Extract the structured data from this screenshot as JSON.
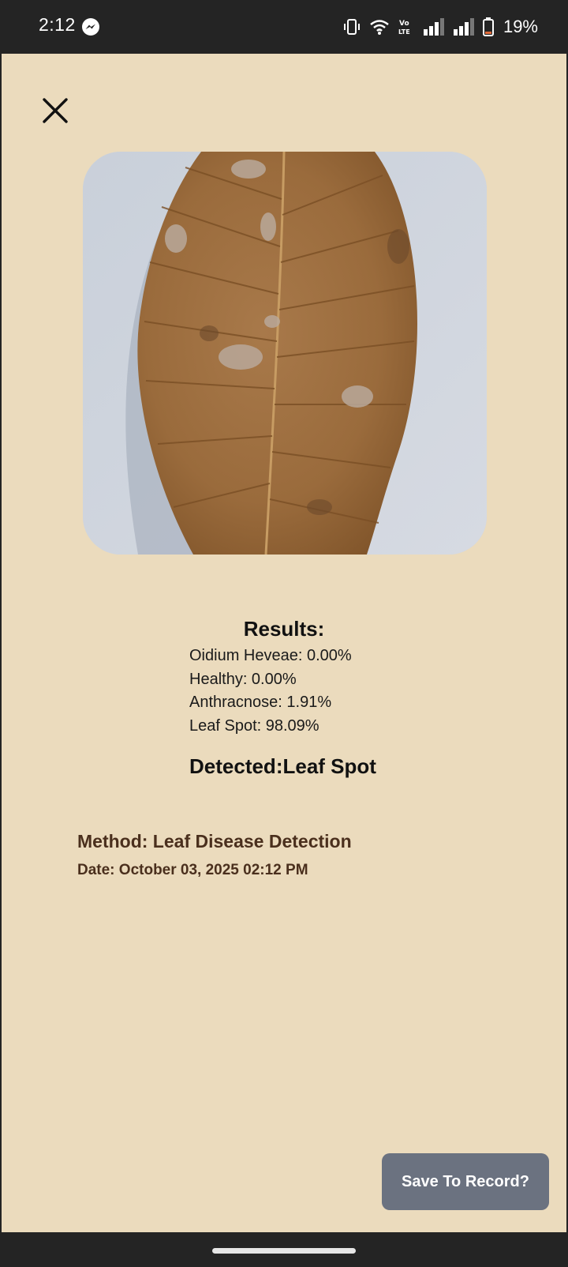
{
  "status_bar": {
    "time": "2:12",
    "battery_percent": "19%",
    "icons": [
      "messenger-icon",
      "vibrate-icon",
      "wifi-icon",
      "volte-icon",
      "signal-icon",
      "signal-icon",
      "battery-icon"
    ]
  },
  "header": {
    "close_icon": "close-icon"
  },
  "image": {
    "subject": "leaf-photo"
  },
  "results": {
    "title": "Results:",
    "items": [
      "Oidium Heveae: 0.00%",
      "Healthy: 0.00%",
      "Anthracnose: 1.91%",
      "Leaf Spot: 98.09%"
    ],
    "detected": "Detected:Leaf Spot"
  },
  "meta": {
    "method": "Method: Leaf Disease Detection",
    "date": "Date: October 03, 2025 02:12 PM"
  },
  "actions": {
    "save_label": "Save To Record?"
  },
  "colors": {
    "background": "#ebdbbd",
    "accent_text": "#4a2f1d",
    "button": "#6b7280"
  }
}
